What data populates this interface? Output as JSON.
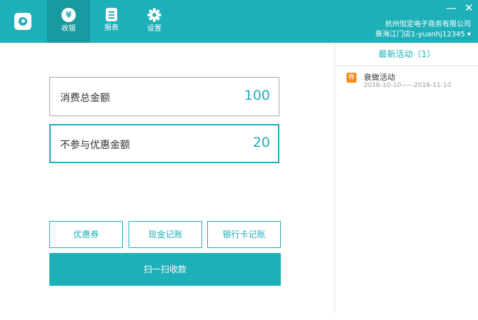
{
  "header": {
    "nav": [
      {
        "label": "收银",
        "icon": "yen-icon",
        "active": true
      },
      {
        "label": "报表",
        "icon": "report-icon",
        "active": false
      },
      {
        "label": "设置",
        "icon": "gear-icon",
        "active": false
      }
    ],
    "minimize_glyph": "—",
    "close_glyph": "✕",
    "company_name": "杭州恒定电子商务有限公司",
    "account": "衰海江门店1-yuanhj12345",
    "dropdown_glyph": "▾"
  },
  "main": {
    "total_label": "消费总金额",
    "total_value": "100",
    "exclude_label": "不参与优惠金额",
    "exclude_value": "20",
    "buttons": {
      "coupon": "优惠券",
      "cash": "现金记账",
      "bank_card": "银行卡记账",
      "scan": "扫一扫收款"
    }
  },
  "sidebar": {
    "title": "最新活动（1）",
    "activities": [
      {
        "badge": "券",
        "name": "衰做活动",
        "dates": "2016-10-10——2016-11-10"
      }
    ]
  },
  "colors": {
    "accent": "#1eb0b8",
    "accent_dark": "#189aa1",
    "badge": "#f28b1d"
  }
}
